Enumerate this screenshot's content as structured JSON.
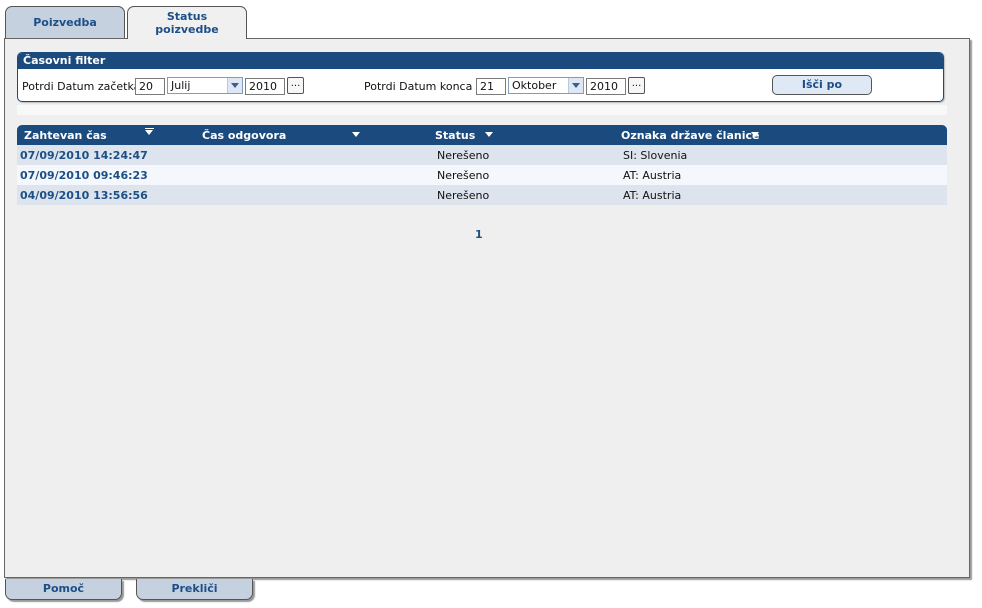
{
  "tabs": {
    "query": "Poizvedba",
    "status_line1": "Status",
    "status_line2": "poizvedbe"
  },
  "filter": {
    "title": "Časovni filter",
    "start_label": "Potrdi Datum začetka",
    "start_day": "20",
    "start_month": "Julij",
    "start_year": "2010",
    "end_label": "Potrdi Datum konca",
    "end_day": "21",
    "end_month": "Oktober",
    "end_year": "2010",
    "picker": "...",
    "search_button": "Išči po"
  },
  "table": {
    "headers": [
      "Zahtevan čas",
      "Čas odgovora",
      "Status",
      "Oznaka države članice"
    ],
    "rows": [
      {
        "requested": "07/09/2010 14:24:47",
        "response": "",
        "status": "Nerešeno",
        "member_state": "SI: Slovenia"
      },
      {
        "requested": "07/09/2010 09:46:23",
        "response": "",
        "status": "Nerešeno",
        "member_state": "AT: Austria"
      },
      {
        "requested": "04/09/2010 13:56:56",
        "response": "",
        "status": "Nerešeno",
        "member_state": "AT: Austria"
      }
    ]
  },
  "pager": {
    "page": "1"
  },
  "bottom": {
    "help": "Pomoč",
    "cancel": "Prekliči"
  },
  "colors": {
    "header_blue": "#1b4a7e",
    "link_blue": "#1d4f87",
    "tab_inactive": "#c6d1e0",
    "row_odd": "#dde4ee",
    "row_even": "#f4f7fb"
  }
}
